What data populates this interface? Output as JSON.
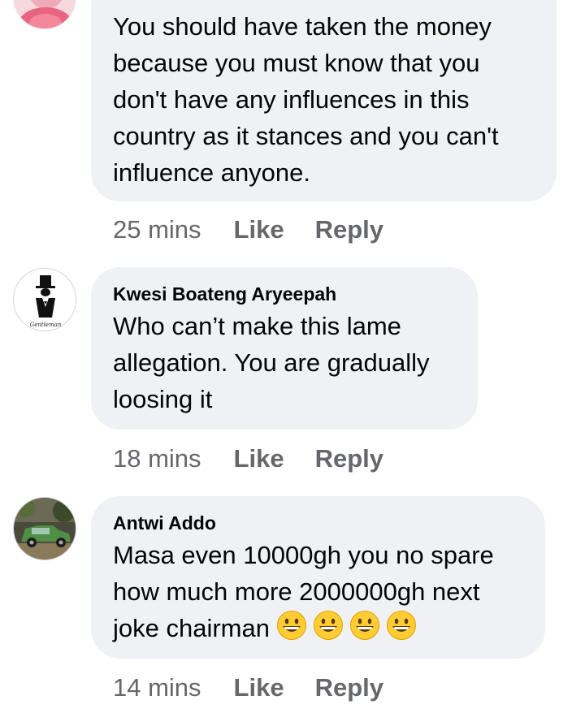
{
  "comments": [
    {
      "author": "",
      "text": "You should have taken the money because you must know that you don't have any influences in this country as it stances and you can't influence anyone.",
      "time": "25 mins",
      "like_label": "Like",
      "reply_label": "Reply",
      "avatar": "pink-photo-avatar"
    },
    {
      "author": "Kwesi Boateng Aryeepah",
      "text": "Who can’t make this lame allegation. You are gradually loosing it",
      "time": "18 mins",
      "like_label": "Like",
      "reply_label": "Reply",
      "avatar": "gentleman-logo-avatar",
      "avatar_caption": "Gentleman"
    },
    {
      "author": "Antwi Addo",
      "text": "Masa even 10000gh you no spare how much more 2000000gh next joke chairman",
      "emoji": [
        "grinning-face-emoji",
        "grinning-face-emoji",
        "grinning-face-emoji",
        "grinning-face-emoji"
      ],
      "time": "14 mins",
      "like_label": "Like",
      "reply_label": "Reply",
      "avatar": "green-car-photo-avatar"
    }
  ],
  "colors": {
    "bubble": "#eff1f4",
    "meta_text": "#65676b",
    "body_text": "#050505"
  }
}
